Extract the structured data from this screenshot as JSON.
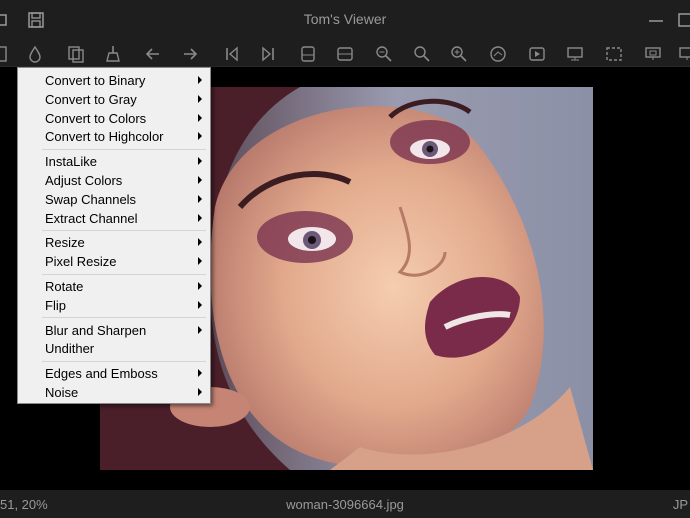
{
  "window": {
    "title": "Tom's Viewer"
  },
  "status": {
    "left_text": "51, 20%",
    "filename": "woman-3096664.jpg",
    "right_text": "JP"
  },
  "toolbar_icons": [
    "panel-icon",
    "color-drop-icon",
    "copy-icon",
    "broom-icon",
    "arrow-left-icon",
    "arrow-right-icon",
    "first-icon",
    "last-icon",
    "flip-horizontal-icon",
    "flip-vertical-icon",
    "zoom-out-icon",
    "zoom-fit-icon",
    "zoom-in-icon",
    "palette-icon",
    "slideshow-icon",
    "monitor-icon",
    "crop-icon",
    "window-icon",
    "more-icon"
  ],
  "menu": {
    "groups": [
      [
        {
          "label": "Convert to Binary",
          "submenu": true
        },
        {
          "label": "Convert to Gray",
          "submenu": true
        },
        {
          "label": "Convert to Colors",
          "submenu": true
        },
        {
          "label": "Convert to Highcolor",
          "submenu": true
        }
      ],
      [
        {
          "label": "InstaLike",
          "submenu": true
        },
        {
          "label": "Adjust Colors",
          "submenu": true
        },
        {
          "label": "Swap Channels",
          "submenu": true
        },
        {
          "label": "Extract Channel",
          "submenu": true
        }
      ],
      [
        {
          "label": "Resize",
          "submenu": true
        },
        {
          "label": "Pixel Resize",
          "submenu": true
        }
      ],
      [
        {
          "label": "Rotate",
          "submenu": true
        },
        {
          "label": "Flip",
          "submenu": true
        }
      ],
      [
        {
          "label": "Blur and Sharpen",
          "submenu": true
        },
        {
          "label": "Undither",
          "submenu": false
        }
      ],
      [
        {
          "label": "Edges and Emboss",
          "submenu": true
        },
        {
          "label": "Noise",
          "submenu": true
        }
      ]
    ]
  }
}
